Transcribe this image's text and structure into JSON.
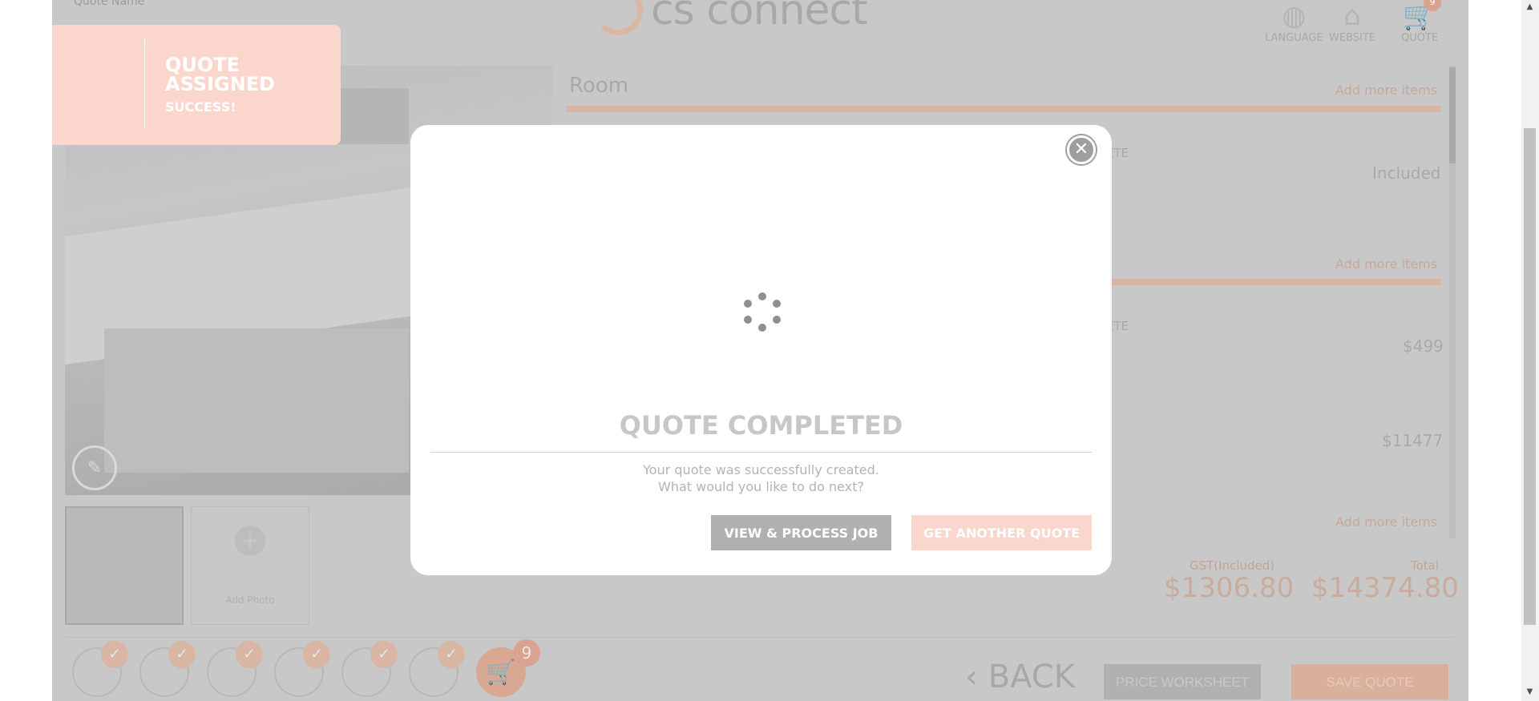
{
  "header": {
    "quote_name_label": "Quote Name",
    "logo_text": "cs connect",
    "nav": [
      {
        "label": "LANGUAGE",
        "icon": "globe-icon"
      },
      {
        "label": "WEBSITE",
        "icon": "home-icon"
      },
      {
        "label": "QUOTE",
        "icon": "cart-icon",
        "badge": "9"
      }
    ]
  },
  "gallery": {
    "add_photo_label": "Add Photo"
  },
  "room": {
    "title": "Room",
    "add_more_label": "Add more items",
    "ete_label": "ETE",
    "prices": [
      "Included",
      "$499",
      "$11477"
    ]
  },
  "totals": {
    "gst_label": "GST(Included)",
    "gst_value": "$1306.80",
    "total_label": "Total",
    "total_value": "$14374.80"
  },
  "footer": {
    "cart_count": "9",
    "back_label": "BACK",
    "price_worksheet_label": "PRICE WORKSHEET",
    "save_quote_label": "SAVE QUOTE"
  },
  "toast": {
    "title": "QUOTE ASSIGNED",
    "subtitle": "SUCCESS!"
  },
  "modal": {
    "title": "QUOTE COMPLETED",
    "message_line1": "Your quote was successfully created.",
    "message_line2": "What would you like to do next?",
    "view_button": "VIEW & PROCESS JOB",
    "another_button": "GET ANOTHER QUOTE"
  },
  "colors": {
    "brand_peach": "#fad6cc",
    "overlay_grey": "#c8c8c8",
    "button_grey": "#b0b0b0"
  }
}
